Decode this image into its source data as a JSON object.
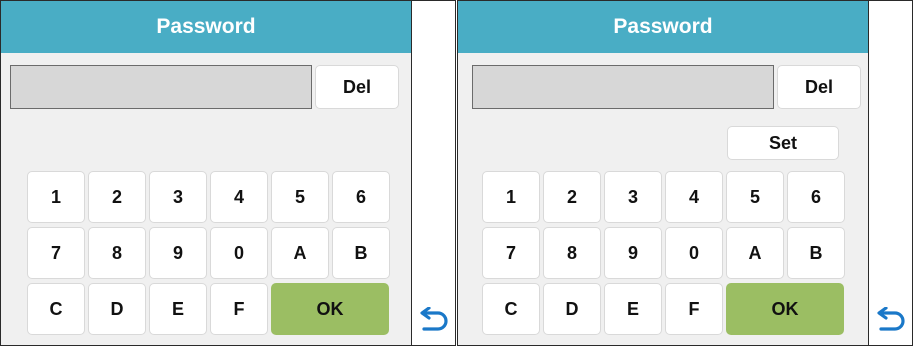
{
  "left_panel": {
    "title": "Password",
    "del_label": "Del",
    "keys": [
      "1",
      "2",
      "3",
      "4",
      "5",
      "6",
      "7",
      "8",
      "9",
      "0",
      "A",
      "B",
      "C",
      "D",
      "E",
      "F"
    ],
    "ok_label": "OK",
    "back_icon": "return-arrow-icon"
  },
  "right_panel": {
    "title": "Password",
    "del_label": "Del",
    "set_label": "Set",
    "keys": [
      "1",
      "2",
      "3",
      "4",
      "5",
      "6",
      "7",
      "8",
      "9",
      "0",
      "A",
      "B",
      "C",
      "D",
      "E",
      "F"
    ],
    "ok_label": "OK",
    "back_icon": "return-arrow-icon"
  },
  "colors": {
    "title_bar": "#49adc5",
    "ok_button": "#9bbe63",
    "back_icon": "#1a78c8",
    "password_field": "#d7d7d7"
  }
}
